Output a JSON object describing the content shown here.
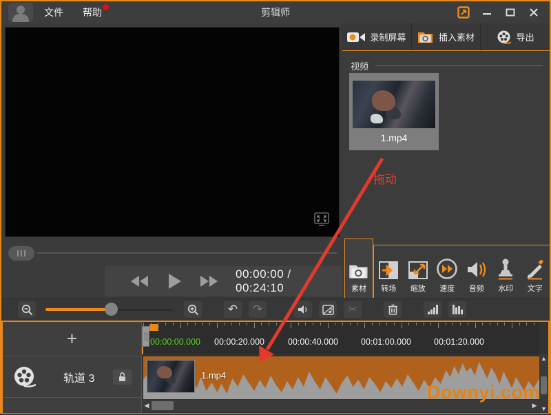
{
  "window": {
    "title": "剪辑师",
    "menu": {
      "file": "文件",
      "help": "帮助"
    },
    "controls": {
      "minimize": "–",
      "maximize": "❐",
      "close": "✕"
    }
  },
  "top_actions": [
    {
      "label": "录制屏幕"
    },
    {
      "label": "插入素材"
    },
    {
      "label": "导出"
    }
  ],
  "library": {
    "section_title": "视频",
    "item_name": "1.mp4",
    "drag_hint": "拖动"
  },
  "tabs": [
    {
      "label": "素材"
    },
    {
      "label": "转场"
    },
    {
      "label": "缩放"
    },
    {
      "label": "速度"
    },
    {
      "label": "音频"
    },
    {
      "label": "水印"
    },
    {
      "label": "文字"
    }
  ],
  "player": {
    "time": "00:00:00 / 00:24:10"
  },
  "toolbar_glyphs": {
    "undo": "↶",
    "redo": "↷",
    "scissors": "✂"
  },
  "timeline": {
    "add_track": "+",
    "track_name": "轨道 3",
    "clip_name": "1.mp4",
    "ruler_labels": [
      "00:00:00.000",
      "00:00:20.000",
      "00:00:40.000",
      "00:01:00.000",
      "00:01:20.000"
    ],
    "scroll_glyphs": {
      "left": "◀",
      "right": "▶",
      "up": "▲",
      "down": "▼"
    }
  },
  "watermark": "Downyi.com",
  "icons": {
    "user-avatar-icon": "person silhouette",
    "record-screen-icon": "camcorder",
    "insert-material-icon": "folder-camera",
    "export-icon": "film-reel",
    "fullscreen-icon": "monitor-expand",
    "lock-open-icon": "open padlock",
    "track-reel-icon": "film-reel"
  },
  "colors": {
    "accent_orange": "#ef8b1d",
    "window_border": "#e8871e",
    "hint_red": "#e23b2e",
    "time_green": "#5ad421",
    "clip_orange": "#b0621d",
    "watermark_orange": "#e8820c"
  }
}
